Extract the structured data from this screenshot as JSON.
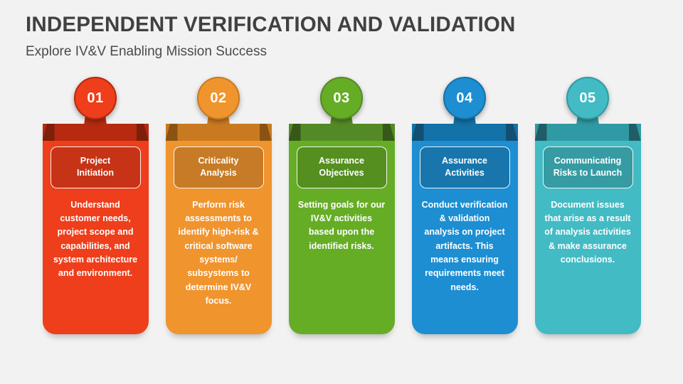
{
  "header": {
    "title": "INDEPENDENT VERIFICATION AND VALIDATION",
    "subtitle": "Explore IV&V Enabling Mission Success"
  },
  "steps": [
    {
      "number": "01",
      "label": "Project\nInitiation",
      "text": "Understand customer needs, project scope and capabilities, and system architecture and environment.",
      "color": "#ee3e1b",
      "dark": "#b62a10",
      "shade": "#7e1f09"
    },
    {
      "number": "02",
      "label": "Criticality\nAnalysis",
      "text": "Perform risk assessments to identify high-risk & critical software systems/ subsystems to determine IV&V focus.",
      "color": "#f0942e",
      "dark": "#c97a20",
      "shade": "#8a5313"
    },
    {
      "number": "03",
      "label": "Assurance\nObjectives",
      "text": "Setting goals for our IV&V activities based upon the identified risks.",
      "color": "#66ad26",
      "dark": "#548a25",
      "shade": "#36591a"
    },
    {
      "number": "04",
      "label": "Assurance\nActivities",
      "text": "Conduct verification & validation analysis on project artifacts. This means ensuring requirements meet needs.",
      "color": "#1d8ed1",
      "dark": "#1372a8",
      "shade": "#124f70"
    },
    {
      "number": "05",
      "label": "Communicating\nRisks to Launch",
      "text": "Document issues that arise as a result of analysis activities & make assurance conclusions.",
      "color": "#42bbc4",
      "dark": "#309aa4",
      "shade": "#1f5e66"
    }
  ]
}
